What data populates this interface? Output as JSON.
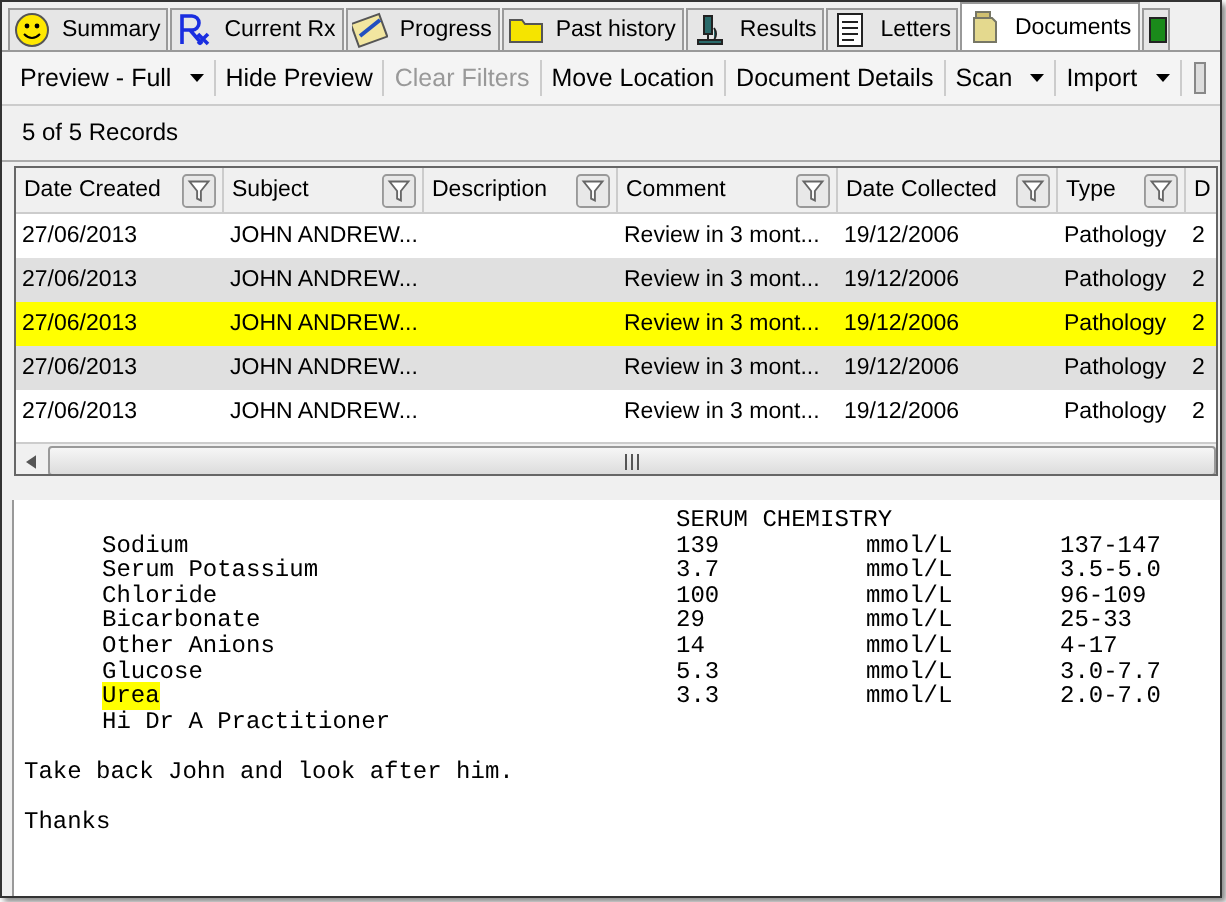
{
  "tabs": [
    {
      "label": "Summary",
      "selected": false
    },
    {
      "label": "Current Rx",
      "selected": false
    },
    {
      "label": "Progress",
      "selected": false
    },
    {
      "label": "Past history",
      "selected": false
    },
    {
      "label": "Results",
      "selected": false
    },
    {
      "label": "Letters",
      "selected": false
    },
    {
      "label": "Documents",
      "selected": true
    }
  ],
  "toolbar": [
    {
      "label": "Preview - Full",
      "dropdown": true,
      "disabled": false
    },
    {
      "label": "Hide Preview",
      "dropdown": false,
      "disabled": false
    },
    {
      "label": "Clear Filters",
      "dropdown": false,
      "disabled": true
    },
    {
      "label": "Move Location",
      "dropdown": false,
      "disabled": false
    },
    {
      "label": "Document Details",
      "dropdown": false,
      "disabled": false
    },
    {
      "label": "Scan",
      "dropdown": true,
      "disabled": false
    },
    {
      "label": "Import",
      "dropdown": true,
      "disabled": false
    }
  ],
  "record_count": "5 of 5 Records",
  "table": {
    "columns": [
      "Date Created",
      "Subject",
      "Description",
      "Comment",
      "Date Collected",
      "Type",
      "D"
    ],
    "rows": [
      {
        "cells": [
          "27/06/2013",
          "JOHN ANDREW...",
          "",
          "Review in 3 mont...",
          "19/12/2006",
          "Pathology",
          "2"
        ],
        "selected": false
      },
      {
        "cells": [
          "27/06/2013",
          "JOHN ANDREW...",
          "",
          "Review in 3 mont...",
          "19/12/2006",
          "Pathology",
          "2"
        ],
        "selected": false
      },
      {
        "cells": [
          "27/06/2013",
          "JOHN ANDREW...",
          "",
          "Review in 3 mont...",
          "19/12/2006",
          "Pathology",
          "2"
        ],
        "selected": true
      },
      {
        "cells": [
          "27/06/2013",
          "JOHN ANDREW...",
          "",
          "Review in 3 mont...",
          "19/12/2006",
          "Pathology",
          "2"
        ],
        "selected": false
      },
      {
        "cells": [
          "27/06/2013",
          "JOHN ANDREW...",
          "",
          "Review in 3 mont...",
          "19/12/2006",
          "Pathology",
          "2"
        ],
        "selected": false
      }
    ]
  },
  "preview": {
    "heading": "SERUM CHEMISTRY",
    "results": [
      {
        "name": "Sodium",
        "value": "139",
        "unit": "mmol/L",
        "range": "137-147",
        "highlighted": false
      },
      {
        "name": "Serum Potassium",
        "value": "3.7",
        "unit": "mmol/L",
        "range": "3.5-5.0",
        "highlighted": false
      },
      {
        "name": "Chloride",
        "value": "100",
        "unit": "mmol/L",
        "range": "96-109",
        "highlighted": false
      },
      {
        "name": "Bicarbonate",
        "value": "29",
        "unit": "mmol/L",
        "range": "25-33",
        "highlighted": false
      },
      {
        "name": "Other Anions",
        "value": "14",
        "unit": "mmol/L",
        "range": "4-17",
        "highlighted": false
      },
      {
        "name": "Glucose",
        "value": "5.3",
        "unit": "mmol/L",
        "range": "3.0-7.7",
        "highlighted": false
      },
      {
        "name": "Urea",
        "value": "3.3",
        "unit": "mmol/L",
        "range": "2.0-7.0",
        "highlighted": true
      }
    ],
    "greeting": "Hi Dr A Practitioner",
    "body": [
      "Take back John and look after him.",
      "Thanks"
    ]
  }
}
